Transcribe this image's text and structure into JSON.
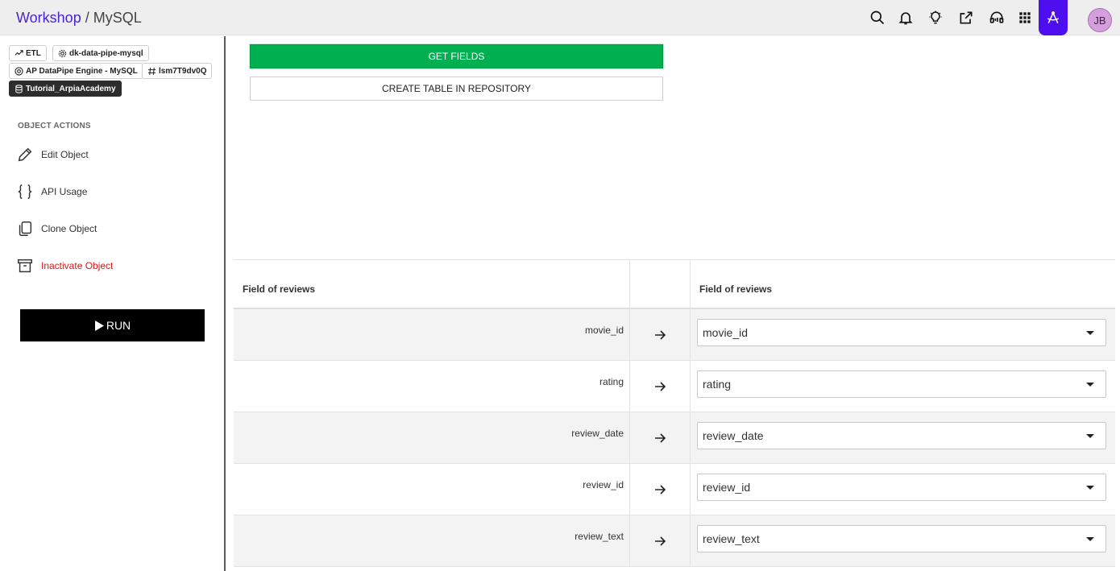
{
  "header": {
    "breadcrumb_root": "Workshop",
    "breadcrumb_separator": "/",
    "breadcrumb_current": "MySQL",
    "icons": [
      "search-icon",
      "bell-icon",
      "lightbulb-icon",
      "share-icon",
      "headset-icon",
      "apps-grid-icon",
      "arpia-assistant-icon"
    ],
    "avatar_initials": "JB",
    "accent_color": "#4d0ff0"
  },
  "sidebar": {
    "tags": {
      "etl": "ETL",
      "datapipe": "dk-data-pipe-mysql",
      "engine": "AP DataPipe Engine - MySQL",
      "object_id": "lsm7T9dv0Q",
      "repository": "Tutorial_ArpiaAcademy"
    },
    "section_title": "OBJECT ACTIONS",
    "actions": [
      {
        "label": "Edit Object",
        "icon": "pencil-icon"
      },
      {
        "label": "API Usage",
        "icon": "braces-icon"
      },
      {
        "label": "Clone Object",
        "icon": "copy-icon"
      },
      {
        "label": "Inactivate Object",
        "icon": "archive-icon"
      }
    ],
    "run_label": "RUN"
  },
  "main": {
    "get_fields_label": "GET FIELDS",
    "create_table_label": "CREATE TABLE IN REPOSITORY",
    "mapping": {
      "source_header": "Field of reviews",
      "target_header": "Field of reviews",
      "rows": [
        {
          "source": "movie_id",
          "target": "movie_id"
        },
        {
          "source": "rating",
          "target": "rating"
        },
        {
          "source": "review_date",
          "target": "review_date"
        },
        {
          "source": "review_id",
          "target": "review_id"
        },
        {
          "source": "review_text",
          "target": "review_text"
        }
      ]
    },
    "primary_color": "#00b050"
  }
}
